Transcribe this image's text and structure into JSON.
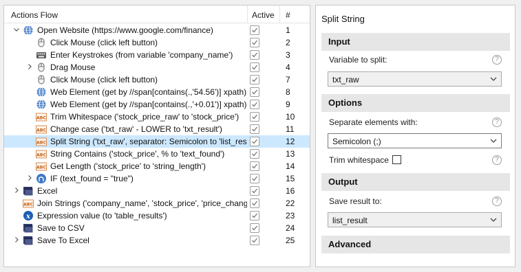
{
  "actions": {
    "header": {
      "title": "Actions Flow",
      "active": "Active",
      "number": "#"
    },
    "rows": [
      {
        "label": "Open Website (https://www.google.com/finance)",
        "num": "1",
        "icon": "globe-icon",
        "indent": 0,
        "expander": "open"
      },
      {
        "label": "Click Mouse (click left button)",
        "num": "2",
        "icon": "mouse-icon",
        "indent": 1,
        "expander": "none"
      },
      {
        "label": "Enter Keystrokes (from variable 'company_name')",
        "num": "3",
        "icon": "keyboard-icon",
        "indent": 1,
        "expander": "none"
      },
      {
        "label": "Drag Mouse",
        "num": "4",
        "icon": "mouse-icon",
        "indent": 1,
        "expander": "closed"
      },
      {
        "label": "Click Mouse (click left button)",
        "num": "7",
        "icon": "mouse-icon",
        "indent": 1,
        "expander": "none"
      },
      {
        "label": "Web Element (get by //span[contains(.,'54.56')] xpath)",
        "num": "8",
        "icon": "globe-icon",
        "indent": 1,
        "expander": "none"
      },
      {
        "label": "Web Element (get by //span[contains(.,'+0.01')] xpath)",
        "num": "9",
        "icon": "globe-icon",
        "indent": 1,
        "expander": "none"
      },
      {
        "label": "Trim Whitespace ('stock_price_raw' to 'stock_price')",
        "num": "10",
        "icon": "text-abc-icon",
        "indent": 1,
        "expander": "none"
      },
      {
        "label": "Change case ('txt_raw' - LOWER to 'txt_result')",
        "num": "11",
        "icon": "text-abc-icon",
        "indent": 1,
        "expander": "none"
      },
      {
        "label": "Split String ('txt_raw', separator: Semicolon to 'list_result')",
        "num": "12",
        "icon": "text-abc-icon",
        "indent": 1,
        "expander": "none",
        "selected": true
      },
      {
        "label": "String Contains ('stock_price', % to 'text_found')",
        "num": "13",
        "icon": "text-abc-icon",
        "indent": 1,
        "expander": "none"
      },
      {
        "label": "Get Length ('stock_price' to 'string_length')",
        "num": "14",
        "icon": "text-abc-icon",
        "indent": 1,
        "expander": "none"
      },
      {
        "label": "IF (text_found = \"true\")",
        "num": "15",
        "icon": "if-branch-icon",
        "indent": 1,
        "expander": "closed"
      },
      {
        "label": "Excel",
        "num": "16",
        "icon": "window-icon",
        "indent": 0,
        "expander": "closed"
      },
      {
        "label": "Join Strings ('company_name', 'stock_price', 'price_change')",
        "num": "22",
        "icon": "text-abc-icon",
        "indent": 0,
        "expander": "none"
      },
      {
        "label": "Expression value (to 'table_results')",
        "num": "23",
        "icon": "expression-x-icon",
        "indent": 0,
        "expander": "none"
      },
      {
        "label": "Save to CSV",
        "num": "24",
        "icon": "window-icon",
        "indent": 0,
        "expander": "none"
      },
      {
        "label": "Save To Excel",
        "num": "25",
        "icon": "window-icon",
        "indent": 0,
        "expander": "closed"
      }
    ]
  },
  "panel": {
    "title": "Split String",
    "input": {
      "heading": "Input",
      "variable_label": "Variable to split:",
      "variable_value": "txt_raw"
    },
    "options": {
      "heading": "Options",
      "separator_label": "Separate elements with:",
      "separator_value": "Semicolon (;)",
      "trim_label": "Trim whitespace"
    },
    "output": {
      "heading": "Output",
      "save_label": "Save result to:",
      "save_value": "list_result"
    },
    "advanced": {
      "heading": "Advanced"
    },
    "help_glyph": "?"
  },
  "colors": {
    "selection": "#cce8ff",
    "section_bg": "#e6e6e6",
    "globe": "#3f78c8",
    "abc": "#d0742a"
  }
}
